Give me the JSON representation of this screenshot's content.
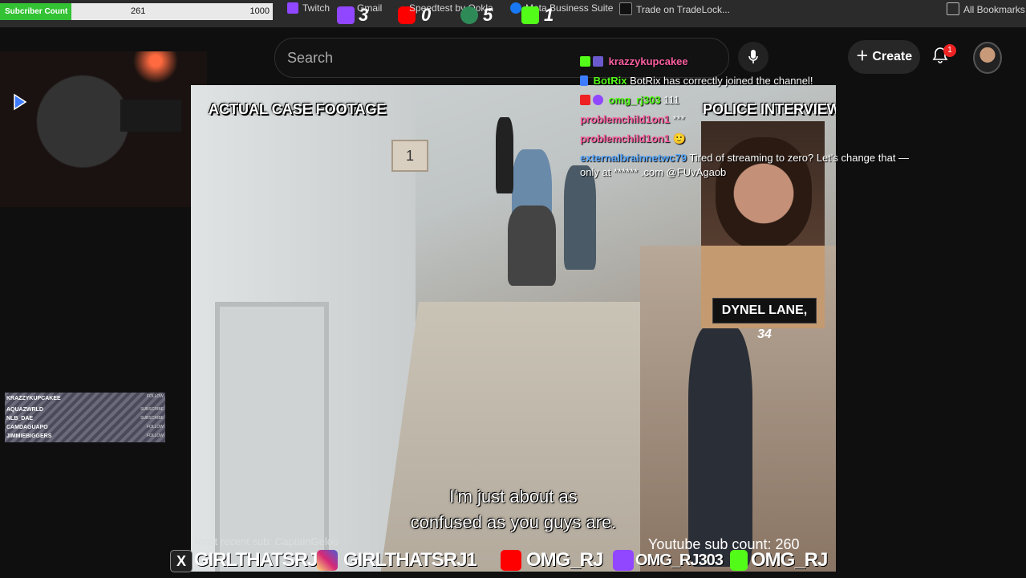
{
  "bookmarks": {
    "subscriber_bar": {
      "label": "Subcriber Count",
      "value": "261",
      "max": "1000",
      "progress": 0.261
    },
    "items": [
      {
        "label": "Twitch"
      },
      {
        "label": "Gmail"
      },
      {
        "label": "Speedtest by Ookla"
      },
      {
        "label": "Meta Business Suite"
      },
      {
        "label": "Trade on TradeLock..."
      }
    ],
    "counters": {
      "twitch": "3",
      "youtube": "0",
      "kick_green": "5",
      "kick": "1"
    },
    "all_bookmarks": "All Bookmarks"
  },
  "youtube": {
    "search_placeholder": "Search",
    "create_label": "Create",
    "notification_count": "1"
  },
  "video": {
    "left_label": "ACTUAL CASE FOOTAGE",
    "right_label": "POLICE INTERVIEW",
    "name_tag": "DYNEL LANE,",
    "name_age": "34",
    "sign_number": "1",
    "subtitle_line1": "I'm just about as",
    "subtitle_line2": "confused as you guys are."
  },
  "chat": [
    {
      "user": "krazzykupcakee",
      "message": "",
      "color": "#ff5fa2"
    },
    {
      "user": "BotRix",
      "message": "BotRix has correctly joined the channel!",
      "color": "#53fc18"
    },
    {
      "user": "omg_rj303",
      "message": "111",
      "color": "#53fc18"
    },
    {
      "user": "problemchild1on1",
      "message": "***",
      "color": "#ff5fa2"
    },
    {
      "user": "problemchild1on1",
      "message": "🙂",
      "color": "#ff5fa2"
    },
    {
      "user": "externalbrainnetwc79",
      "message": "Tired of streaming to zero? Let's change that —",
      "color": "#5aa9ff"
    },
    {
      "user": "",
      "message": "only at ****** .com @FUvAgaob",
      "color": "#ffffff"
    }
  ],
  "alerts": [
    {
      "name": "KRAZZYKUPCAKEE",
      "type": "FOLLOW"
    },
    {
      "name": "AQUAZWRLD",
      "type": "SUBSCRIBE"
    },
    {
      "name": "NLB_DAE",
      "type": "SUBSCRIBE"
    },
    {
      "name": "CAMDAGUAPO",
      "type": "FOLLOW"
    },
    {
      "name": "JIMMIEBIGGERS",
      "type": "FOLLOW"
    }
  ],
  "footer": {
    "recent_sub": "most recent sub: CaptainGeloo",
    "yt_sub_count": "Youtube sub count: 260",
    "socials": {
      "x": "GIRLTHATSRJ",
      "instagram": "GIRLTHATSRJ1",
      "youtube": "OMG_RJ",
      "twitch": "OMG_RJ303",
      "kick": "OMG_RJ"
    }
  },
  "colors": {
    "subscriber_fill": "#33c233",
    "youtube_red": "#ff0000",
    "twitch_purple": "#9146ff",
    "kick_green": "#53fc18",
    "instagram": "#d6249f"
  }
}
